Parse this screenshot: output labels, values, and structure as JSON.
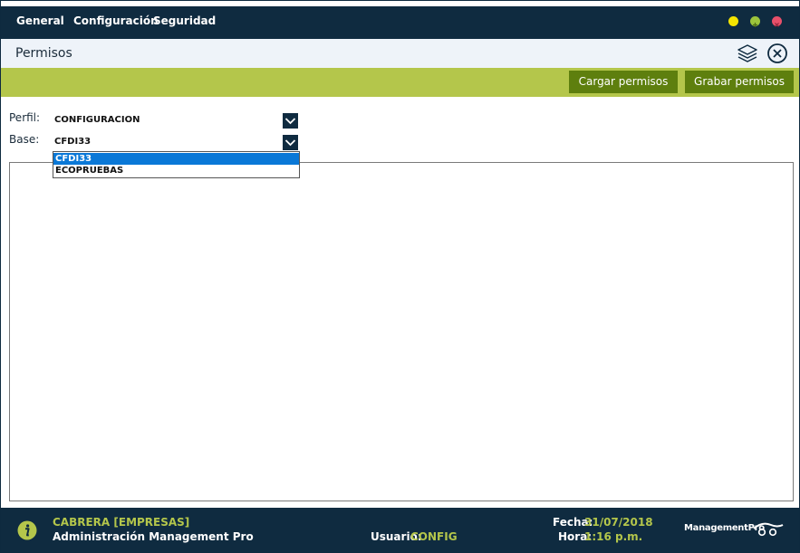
{
  "menu": {
    "items": [
      {
        "label": "General"
      },
      {
        "label": "Configuración"
      },
      {
        "label": "Seguridad"
      }
    ],
    "window_buttons": [
      "minimize",
      "maximize",
      "close"
    ]
  },
  "titlebar": {
    "title": "Permisos",
    "icons": [
      "layers-icon",
      "close-circle-icon"
    ]
  },
  "toolbar": {
    "load_label": "Cargar permisos",
    "save_label": "Grabar permisos"
  },
  "form": {
    "perfil_label": "Perfil:",
    "perfil_value": "CONFIGURACION",
    "base_label": "Base:",
    "base_value": "CFDI33",
    "base_options": [
      "CFDI33",
      "ECOPRUEBAS"
    ],
    "base_selected_index": 0
  },
  "status": {
    "company": "CABRERA [EMPRESAS]",
    "app_name": "Administración Management Pro",
    "user_label": "Usuario:",
    "user_value": "CONFIG",
    "date_label": "Fecha:",
    "date_value": "31/07/2018",
    "time_label": "Hora:",
    "time_value": "1:16 p.m.",
    "brand": "ManagementPro"
  },
  "colors": {
    "navy": "#0f2b40",
    "lime": "#b4c64b",
    "button_green": "#5e7f0e",
    "selection_blue": "#0a78d7",
    "dot_yellow": "#f4e400",
    "dot_green": "#9cc43c",
    "dot_red": "#e8506a"
  }
}
